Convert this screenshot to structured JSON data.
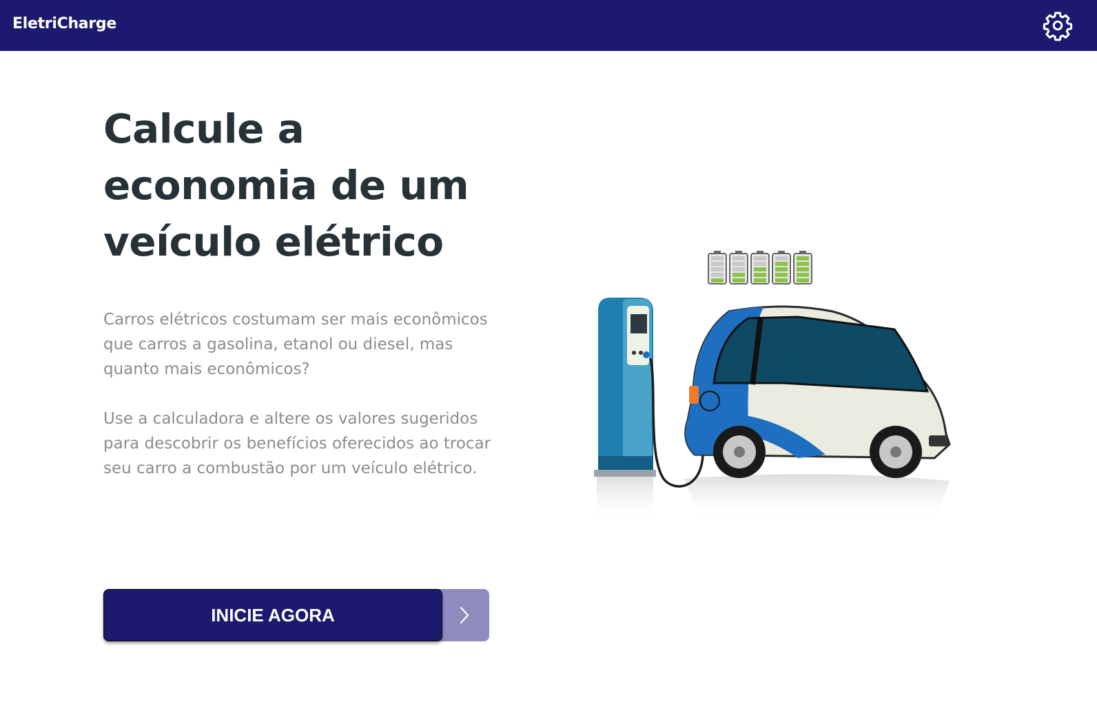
{
  "app": {
    "brand": "EletriCharge"
  },
  "header": {
    "settings_icon": "gear-icon"
  },
  "hero": {
    "headline": "Calcule a economia de um veículo elétrico",
    "paragraph1": "Carros elétricos costumam ser mais econômicos que carros a gasolina, etanol ou diesel, mas quanto mais econômicos?",
    "paragraph2": "Use a calculadora  e altere os valores sugeridos para descobrir os benefícios oferecidos ao trocar seu carro a combustão por um veículo elétrico."
  },
  "cta": {
    "label": "INICIE AGORA",
    "arrow_icon": "chevron-right-icon"
  },
  "illustration": {
    "batteries_charge_levels": [
      0.2,
      0.4,
      0.6,
      0.8,
      1.0
    ]
  },
  "colors": {
    "nav_bg": "#1c1a6e",
    "headline": "#263238",
    "body_text": "#8c8c8c",
    "button_bg": "#1c1a6e",
    "button_secondary": "#8e8bbf",
    "battery_green": "#8bc34a",
    "car_blue": "#1f6fc0"
  }
}
